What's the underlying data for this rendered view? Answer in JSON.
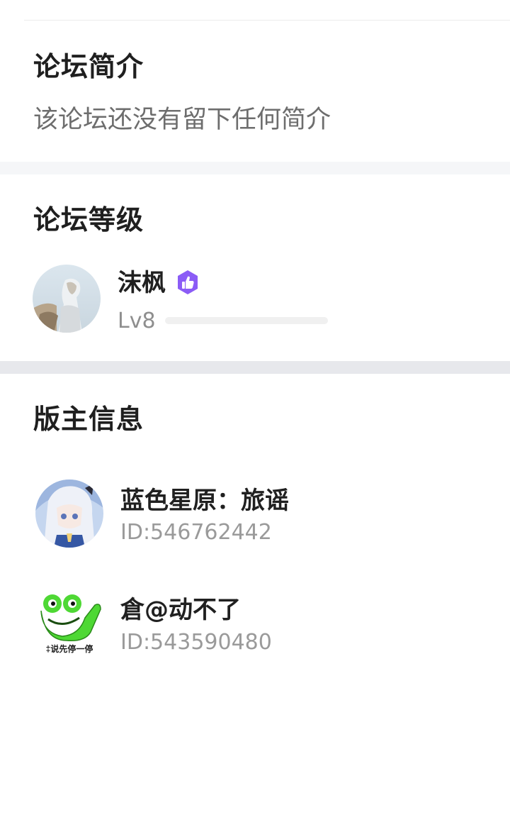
{
  "intro": {
    "title": "论坛简介",
    "text": "该论坛还没有留下任何简介"
  },
  "level": {
    "title": "论坛等级",
    "user": {
      "name": "沫枫",
      "badge_icon": "thumbs-up-badge-icon",
      "badge_color": "#8b5cf6",
      "level_label": "Lv8",
      "progress": 0.0
    }
  },
  "moderators": {
    "title": "版主信息",
    "items": [
      {
        "name": "蓝色星原：旅谣",
        "id": "ID:546762442"
      },
      {
        "name": "倉@动不了",
        "id": "ID:543590480"
      }
    ]
  },
  "avatar_overlays": {
    "frog_caption": "‡说先停一停"
  }
}
